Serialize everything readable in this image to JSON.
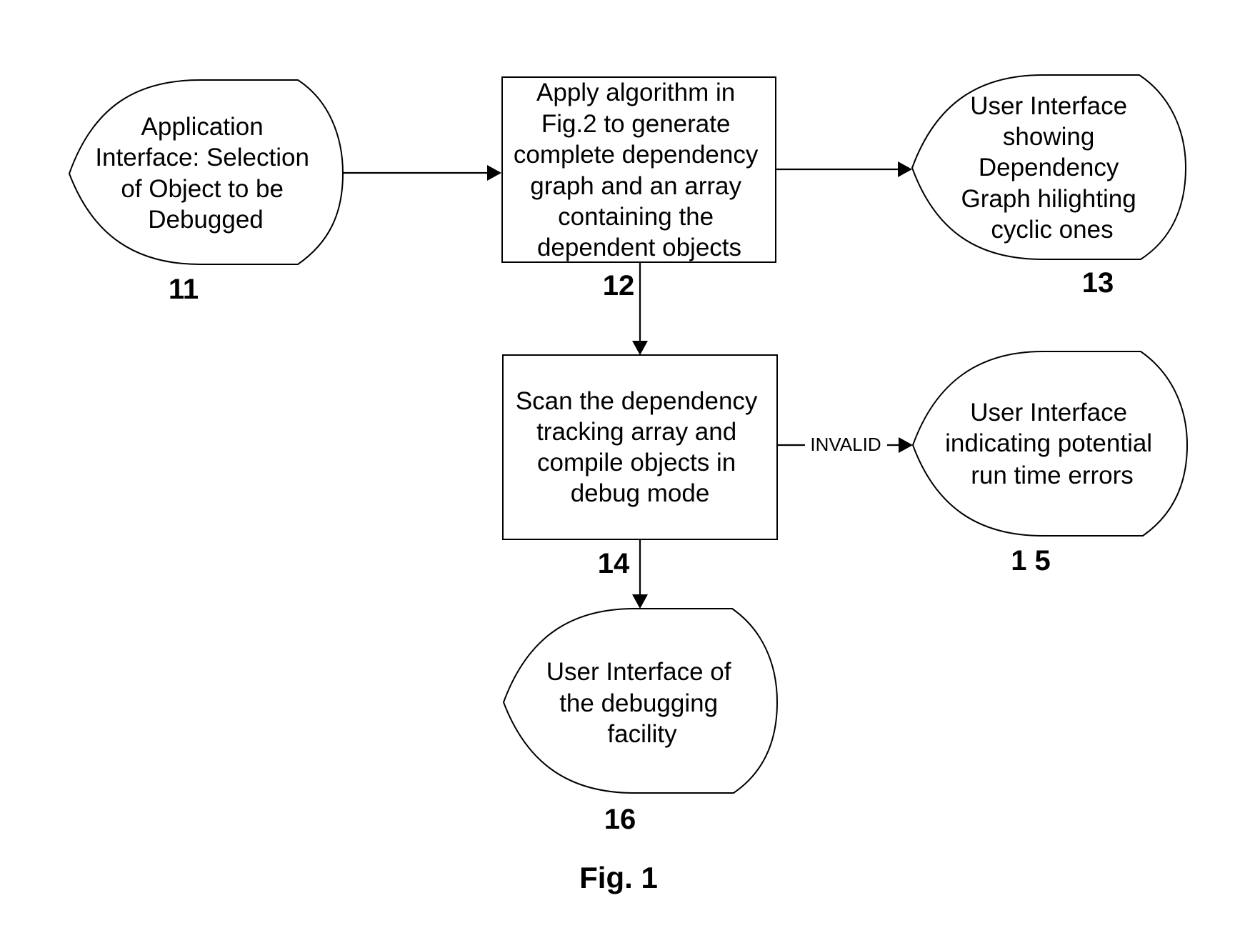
{
  "figure": {
    "caption": "Fig. 1"
  },
  "nodes": [
    {
      "id": "11",
      "ref": "11",
      "kind": "display",
      "lines": [
        "Application",
        "Interface: Selection",
        "of Object to be",
        "Debugged"
      ]
    },
    {
      "id": "12",
      "ref": "12",
      "kind": "process",
      "lines": [
        "Apply algorithm in",
        "Fig.2 to generate",
        "complete dependency",
        "graph and an array",
        "containing the",
        "dependent objects"
      ]
    },
    {
      "id": "13",
      "ref": "13",
      "kind": "display",
      "lines": [
        "User Interface",
        "showing",
        "Dependency",
        "Graph hilighting",
        "cyclic ones"
      ]
    },
    {
      "id": "14",
      "ref": "14",
      "kind": "process",
      "lines": [
        "Scan the dependency",
        "tracking array and",
        "compile objects in",
        "debug mode"
      ]
    },
    {
      "id": "15",
      "ref": "1 5",
      "kind": "display",
      "lines": [
        "User Interface",
        "indicating potential",
        "run time errors"
      ]
    },
    {
      "id": "16",
      "ref": "16",
      "kind": "display",
      "lines": [
        "User Interface of",
        "the debugging",
        "facility"
      ]
    }
  ],
  "edges": [
    {
      "from": "11",
      "to": "12",
      "label": ""
    },
    {
      "from": "12",
      "to": "13",
      "label": ""
    },
    {
      "from": "12",
      "to": "14",
      "label": ""
    },
    {
      "from": "14",
      "to": "15",
      "label": "INVALID"
    },
    {
      "from": "14",
      "to": "16",
      "label": ""
    }
  ]
}
